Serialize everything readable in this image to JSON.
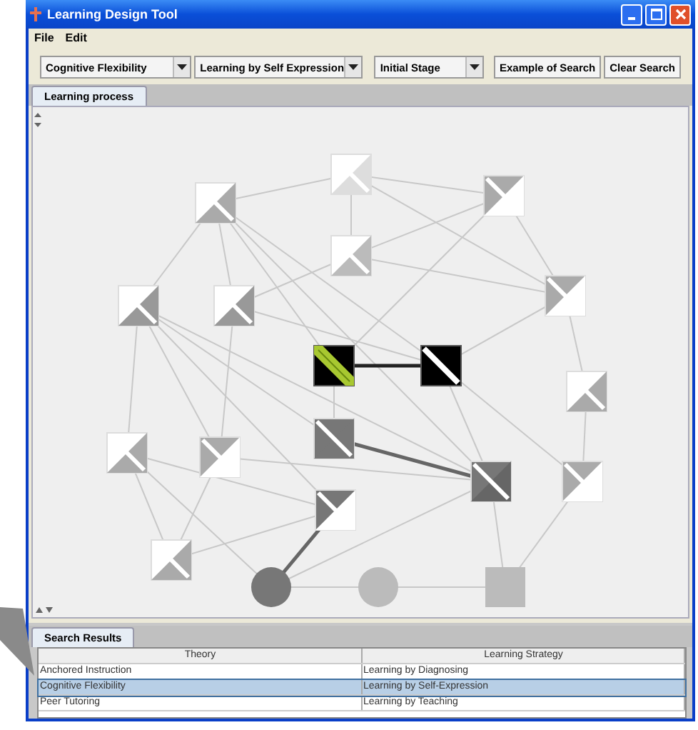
{
  "window": {
    "title": "Learning Design Tool"
  },
  "menu": [
    "File",
    "Edit"
  ],
  "toolbar": {
    "combos": [
      {
        "value": "Cognitive Flexibility"
      },
      {
        "value": "Learning by Self Expression"
      },
      {
        "value": "Initial Stage"
      }
    ],
    "buttons": [
      "Example of Search",
      "Clear Search"
    ]
  },
  "tabs": [
    {
      "label": "Learning process",
      "selected": true
    }
  ],
  "results_tabs": [
    {
      "label": "Search Results",
      "selected": true
    }
  ],
  "table": {
    "columns": [
      "Theory",
      "Learning Strategy"
    ],
    "rows": [
      {
        "cells": [
          "Anchored Instruction",
          "Learning by Diagnosing"
        ],
        "selected": false
      },
      {
        "cells": [
          "Cognitive Flexibility",
          "Learning by Self-Expression"
        ],
        "selected": true
      },
      {
        "cells": [
          "Peer Tutoring",
          "Learning by Teaching"
        ],
        "selected": false
      }
    ]
  }
}
